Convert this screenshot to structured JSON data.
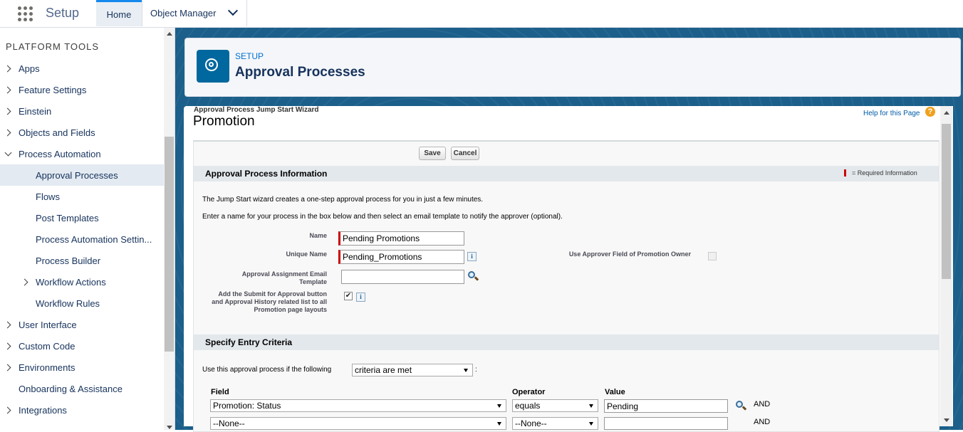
{
  "topbar": {
    "app_name": "Setup",
    "tabs": [
      {
        "label": "Home"
      },
      {
        "label": "Object Manager"
      }
    ]
  },
  "sidebar": {
    "heading": "PLATFORM TOOLS",
    "items": [
      {
        "label": "Apps"
      },
      {
        "label": "Feature Settings"
      },
      {
        "label": "Einstein"
      },
      {
        "label": "Objects and Fields"
      },
      {
        "label": "Process Automation"
      },
      {
        "label": "Approval Processes"
      },
      {
        "label": "Flows"
      },
      {
        "label": "Post Templates"
      },
      {
        "label": "Process Automation Settin..."
      },
      {
        "label": "Process Builder"
      },
      {
        "label": "Workflow Actions"
      },
      {
        "label": "Workflow Rules"
      },
      {
        "label": "User Interface"
      },
      {
        "label": "Custom Code"
      },
      {
        "label": "Environments"
      },
      {
        "label": "Onboarding & Assistance"
      },
      {
        "label": "Integrations"
      }
    ]
  },
  "header": {
    "breadcrumb": "SETUP",
    "title": "Approval Processes"
  },
  "wizard": {
    "label": "Approval Process Jump Start Wizard",
    "title": "Promotion",
    "help_link": "Help for this Page",
    "help_icon": "?",
    "save_label": "Save",
    "cancel_label": "Cancel"
  },
  "info_section": {
    "title": "Approval Process Information",
    "required_text": "= Required Information",
    "intro1": "The Jump Start wizard creates a one-step approval process for you in just a few minutes.",
    "intro2": "Enter a name for your process in the box below and then select an email template to notify the approver (optional).",
    "name_label": "Name",
    "name_value": "Pending Promotions",
    "unique_name_label": "Unique Name",
    "unique_name_value": "Pending_Promotions",
    "approver_field_label": "Use Approver Field of Promotion Owner",
    "email_template_label": "Approval Assignment Email Template",
    "email_template_value": "",
    "submit_label": "Add the Submit for Approval button and Approval History related list to all Promotion page layouts",
    "submit_checked": true,
    "info_glyph": "i",
    "check_glyph": "✔"
  },
  "criteria_section": {
    "title": "Specify Entry Criteria",
    "use_text": "Use this approval process if the following",
    "criteria_select": "criteria are met",
    "colon": ":",
    "headers": {
      "field": "Field",
      "operator": "Operator",
      "value": "Value"
    },
    "rows": [
      {
        "field": "Promotion: Status",
        "operator": "equals",
        "value": "Pending",
        "conj": "AND"
      },
      {
        "field": "--None--",
        "operator": "--None--",
        "value": "",
        "conj": "AND"
      }
    ]
  }
}
